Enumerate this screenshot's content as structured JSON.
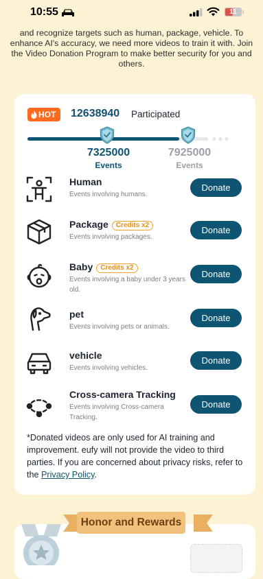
{
  "status_bar": {
    "time": "10:55",
    "battery": "11"
  },
  "intro_text": "and recognize targets such as human, package, vehicle. To enhance AI's accuracy, we need more videos to train it with. Join the Video Donation Program to make better security for you and others.",
  "stats": {
    "hot_label": "HOT",
    "participated_count": "12638940",
    "participated_label": "Participated"
  },
  "progress": {
    "fraction": 0.84,
    "milestones": [
      {
        "value": "7325000",
        "label": "Events",
        "reached": true
      },
      {
        "value": "7925000",
        "label": "Events",
        "reached": false
      }
    ]
  },
  "categories": [
    {
      "title": "Human",
      "credits": "",
      "desc": "Events involving humans.",
      "button": "Donate",
      "icon": "human-icon"
    },
    {
      "title": "Package",
      "credits": "Credits x2",
      "desc": "Events involving packages.",
      "button": "Donate",
      "icon": "package-icon"
    },
    {
      "title": "Baby",
      "credits": "Credits x2",
      "desc": "Events involving a baby under 3 years old.",
      "button": "Donate",
      "icon": "baby-icon"
    },
    {
      "title": "pet",
      "credits": "",
      "desc": "Events involving pets or animals.",
      "button": "Donate",
      "icon": "pet-icon"
    },
    {
      "title": "vehicle",
      "credits": "",
      "desc": "Events involving vehicles.",
      "button": "Donate",
      "icon": "vehicle-icon"
    },
    {
      "title": "Cross-camera Tracking",
      "credits": "",
      "desc": "Events involving Cross-camera Tracking.",
      "button": "Donate",
      "icon": "cross-camera-icon"
    }
  ],
  "disclaimer": {
    "text": "*Donated videos are only used for AI training and improvement. eufy will not provide the video to third parties. If you are concerned about privacy risks, refer to the ",
    "link": "Privacy Policy",
    "end": "."
  },
  "honor": {
    "title": "Honor and Rewards"
  },
  "colors": {
    "accent": "#0f5472",
    "hot": "#ff6a1f",
    "background": "#fdf3d4",
    "credits": "#e88c12"
  }
}
